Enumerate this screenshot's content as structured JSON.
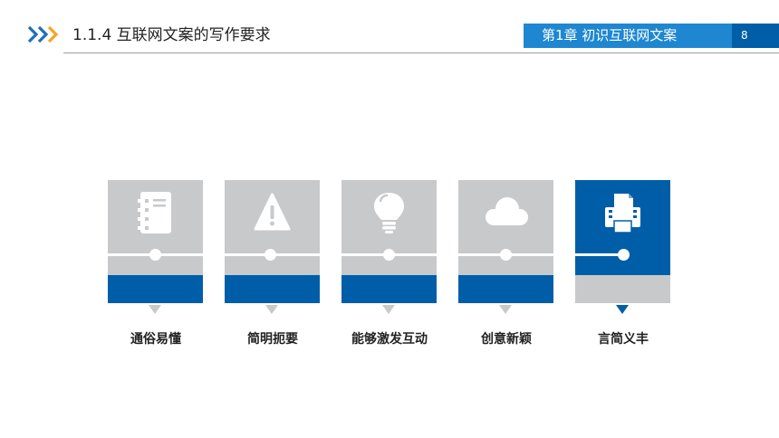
{
  "header": {
    "section_title": "1.1.4  互联网文案的写作要求",
    "chapter": "第1章   初识互联网文案",
    "page_number": "8"
  },
  "features": [
    {
      "label": "通俗易懂",
      "icon": "document-icon",
      "active": false
    },
    {
      "label": "简明扼要",
      "icon": "warning-icon",
      "active": false
    },
    {
      "label": "能够激发互动",
      "icon": "lightbulb-icon",
      "active": false
    },
    {
      "label": "创意新颖",
      "icon": "cloud-icon",
      "active": false
    },
    {
      "label": "言简义丰",
      "icon": "printer-icon",
      "active": true
    }
  ],
  "colors": {
    "primary_blue": "#005ea8",
    "chapter_blue": "#1f87d1",
    "card_gray": "#c8c9cb",
    "chevron_blue": "#1f6fb8",
    "chevron_orange": "#f5a623"
  }
}
